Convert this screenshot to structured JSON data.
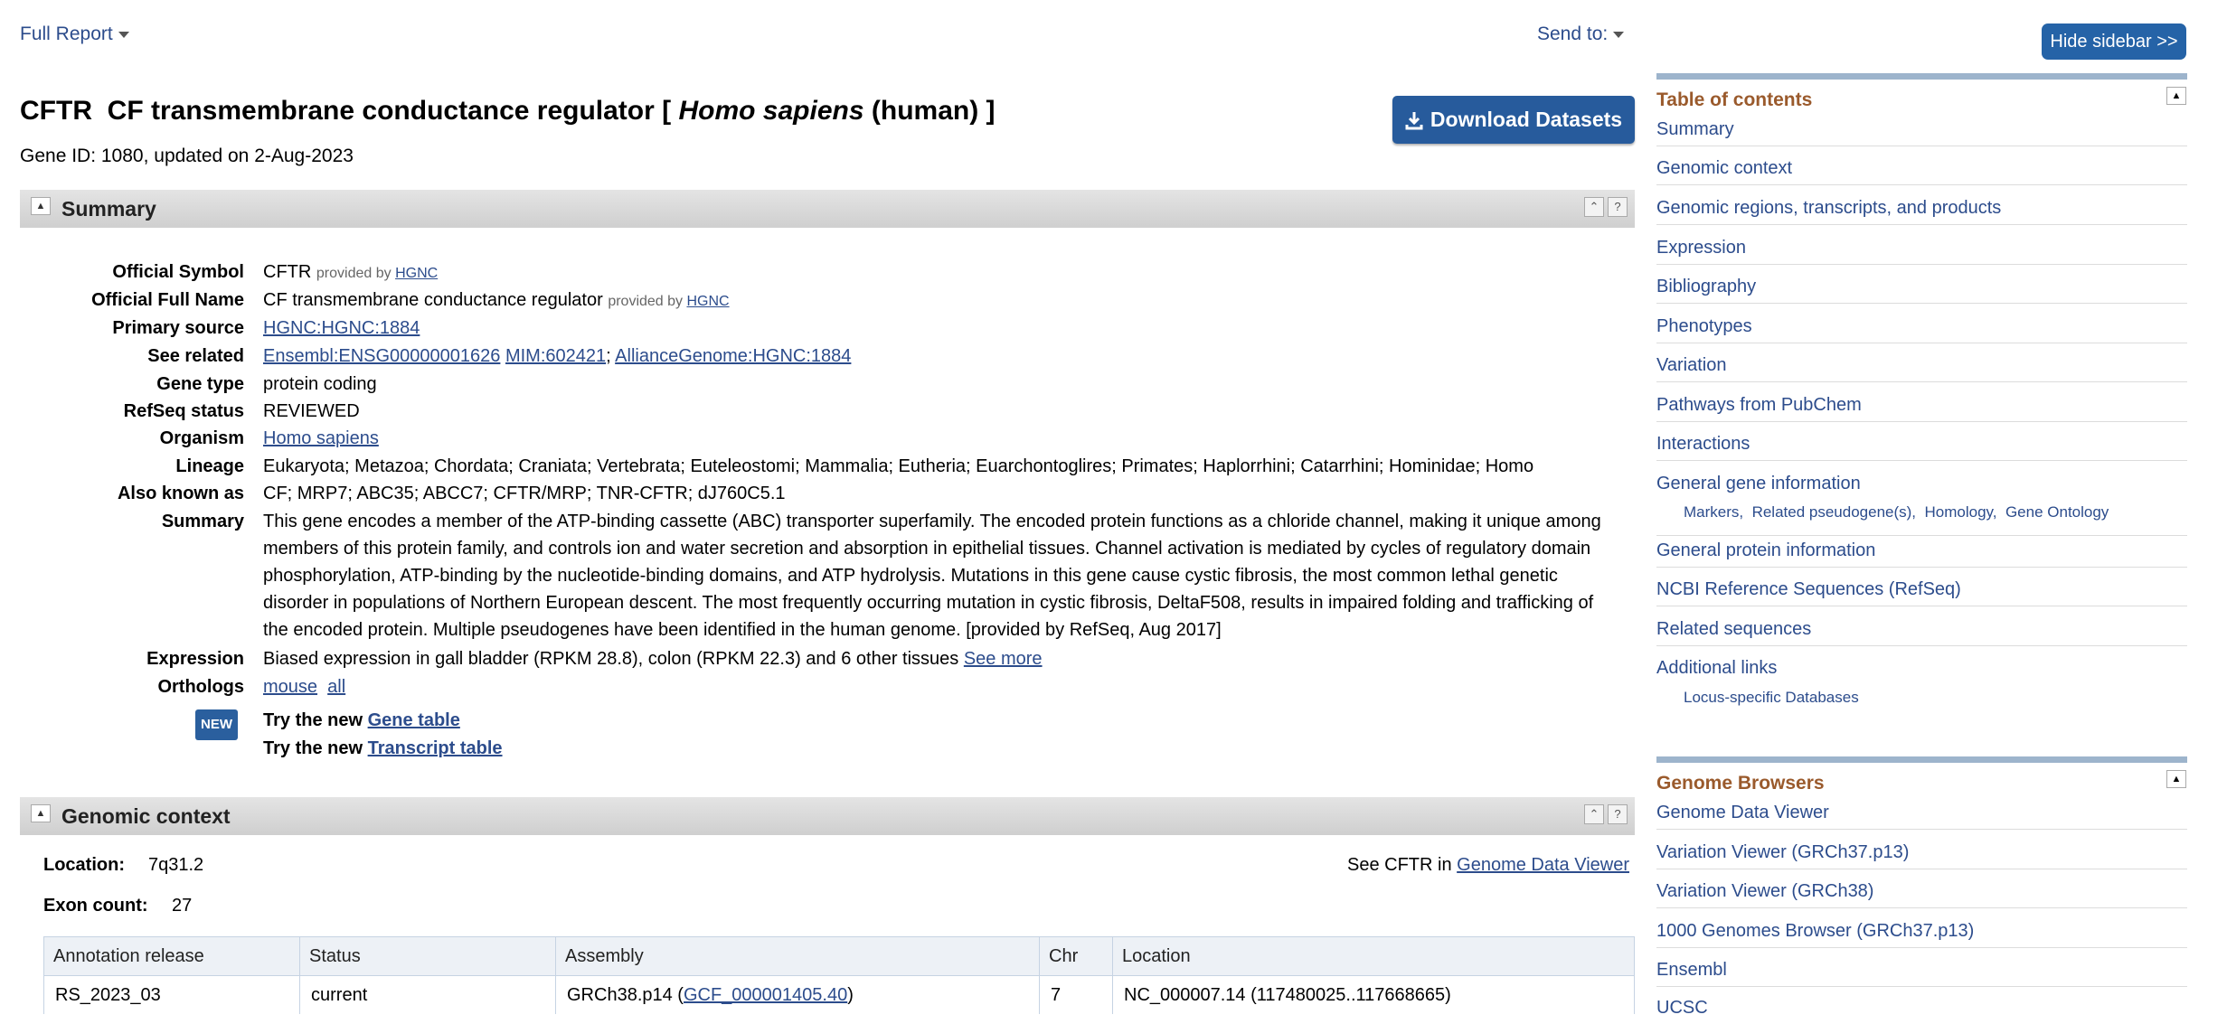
{
  "topbar": {
    "full_report": "Full Report",
    "send_to": "Send to:"
  },
  "sidebar_toggle": "Hide sidebar >>",
  "title": {
    "symbol": "CFTR",
    "name": "CF transmembrane conductance regulator [",
    "species": "Homo sapiens",
    "common": "(human) ]"
  },
  "gene_id_line": "Gene ID: 1080, updated on 2-Aug-2023",
  "download_label": "Download Datasets",
  "summary": {
    "header": "Summary",
    "rows": [
      {
        "label": "Official Symbol",
        "value": "CFTR",
        "provided": "provided by",
        "provider": "HGNC"
      },
      {
        "label": "Official Full Name",
        "value": "CF transmembrane conductance regulator",
        "provided": "provided by",
        "provider": "HGNC"
      },
      {
        "label": "Primary source",
        "value": "HGNC:HGNC:1884"
      },
      {
        "label": "See related",
        "links": [
          "Ensembl:ENSG00000001626",
          "MIM:602421",
          "AllianceGenome:HGNC:1884"
        ]
      },
      {
        "label": "Gene type",
        "value": "protein coding"
      },
      {
        "label": "RefSeq status",
        "value": "REVIEWED"
      },
      {
        "label": "Organism",
        "value": "Homo sapiens"
      },
      {
        "label": "Lineage",
        "value": "Eukaryota; Metazoa; Chordata; Craniata; Vertebrata; Euteleostomi; Mammalia; Eutheria; Euarchontoglires; Primates; Haplorrhini; Catarrhini; Hominidae; Homo"
      },
      {
        "label": "Also known as",
        "value": "CF; MRP7; ABC35; ABCC7; CFTR/MRP; TNR-CFTR; dJ760C5.1"
      },
      {
        "label": "Summary",
        "value": "This gene encodes a member of the ATP-binding cassette (ABC) transporter superfamily. The encoded protein functions as a chloride channel, making it unique among members of this protein family, and controls ion and water secretion and absorption in epithelial tissues. Channel activation is mediated by cycles of regulatory domain phosphorylation, ATP-binding by the nucleotide-binding domains, and ATP hydrolysis. Mutations in this gene cause cystic fibrosis, the most common lethal genetic disorder in populations of Northern European descent. The most frequently occurring mutation in cystic fibrosis, DeltaF508, results in impaired folding and trafficking of the encoded protein. Multiple pseudogenes have been identified in the human genome. [provided by RefSeq, Aug 2017]"
      },
      {
        "label": "Expression",
        "value": "Biased expression in gall bladder (RPKM 28.8), colon (RPKM 22.3) and 6 other tissues",
        "link": "See more"
      },
      {
        "label": "Orthologs",
        "links": [
          "mouse",
          "all"
        ]
      }
    ],
    "new_badge": "NEW",
    "try_prefix": "Try the new",
    "gene_table": "Gene table",
    "transcript_table": "Transcript table"
  },
  "genomic": {
    "header": "Genomic context",
    "location_label": "Location:",
    "location_value": "7q31.2",
    "exon_label": "Exon count:",
    "exon_value": "27",
    "see_prefix": "See CFTR in",
    "see_link": "Genome Data Viewer",
    "columns": [
      "Annotation release",
      "Status",
      "Assembly",
      "Chr",
      "Location"
    ],
    "row": {
      "release": "RS_2023_03",
      "status": "current",
      "assembly": "GRCh38.p14 (",
      "assembly_link": "GCF_000001405.40",
      "assembly_end": ")",
      "chr": "7",
      "location": "NC_000007.14 (117480025..117668665)"
    }
  },
  "toc": {
    "header": "Table of contents",
    "items": [
      "Summary",
      "Genomic context",
      "Genomic regions, transcripts, and products",
      "Expression",
      "Bibliography",
      "Phenotypes",
      "Variation",
      "Pathways from PubChem",
      "Interactions",
      "General gene information",
      "General protein information",
      "NCBI Reference Sequences (RefSeq)",
      "Related sequences",
      "Additional links"
    ],
    "sub_general": [
      "Markers,",
      "Related pseudogene(s),",
      "Homology,",
      "Gene Ontology"
    ],
    "sub_additional": "Locus-specific Databases"
  },
  "browsers": {
    "header": "Genome Browsers",
    "items": [
      "Genome Data Viewer",
      "Variation Viewer (GRCh37.p13)",
      "Variation Viewer (GRCh38)",
      "1000 Genomes Browser (GRCh37.p13)",
      "Ensembl",
      "UCSC"
    ]
  }
}
